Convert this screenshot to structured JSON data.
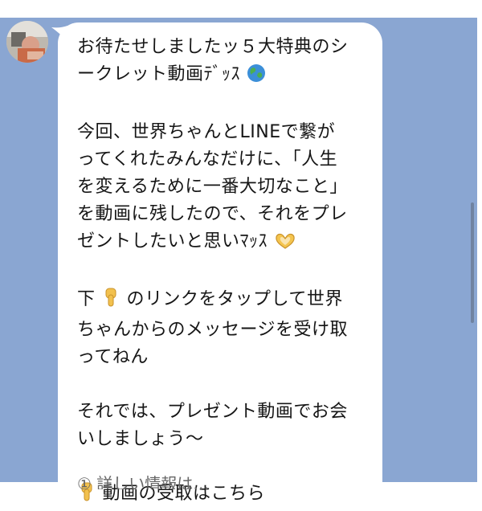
{
  "message": {
    "line1": "お待たせしましたッ５大特典のシ",
    "line2": "ークレット動画ﾃﾞｯｽ",
    "line3": "今回、世界ちゃんとLINEで繋が",
    "line4": "ってくれたみんなだけに、「人生",
    "line5": "を変えるために一番大切なこと」",
    "line6": "を動画に残したので、それをプレ",
    "line7": "ゼントしたいと思いﾏｯｽ",
    "line8": "下",
    "line8b": "のリンクをタップして世界",
    "line9": "ちゃんからのメッセージを受け取",
    "line10": "ってねん",
    "line11": "それでは、プレゼント動画でお会",
    "line12": "いしましょう〜",
    "line13": "動画の受取はこちら",
    "line14": "① 詳しい情報は…"
  },
  "icons": {
    "globe": "globe-emoji-icon",
    "heart_hands": "heart-hands-emoji-icon",
    "point_down": "pointing-down-emoji-icon"
  },
  "colors": {
    "chat_background": "#8aa6d2",
    "bubble": "#ffffff",
    "text": "#161616"
  }
}
